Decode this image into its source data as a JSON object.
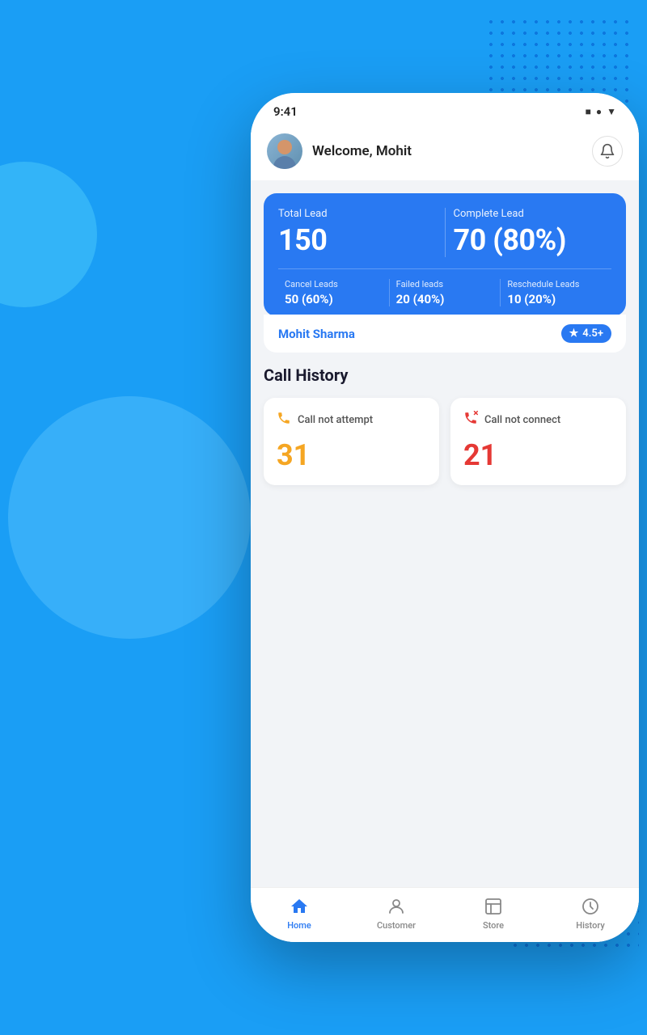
{
  "background": {
    "color": "#1a9ef5"
  },
  "statusBar": {
    "time": "9:41",
    "icons": [
      "■",
      "●",
      "▼"
    ]
  },
  "header": {
    "welcome": "Welcome, Mohit",
    "bell_label": "notifications"
  },
  "leadCard": {
    "total_lead_label": "Total Lead",
    "total_lead_value": "150",
    "complete_lead_label": "Complete Lead",
    "complete_lead_value": "70 (80%)",
    "stats": [
      {
        "label": "Cancel Leads",
        "value": "50 (60%)"
      },
      {
        "label": "Failed leads",
        "value": "20 (40%)"
      },
      {
        "label": "Reschedule Leads",
        "value": "10 (20%)"
      }
    ]
  },
  "profileRow": {
    "name": "Mohit Sharma",
    "rating": "4.5+"
  },
  "callHistory": {
    "section_title": "Call History",
    "cards": [
      {
        "label": "Call not attempt",
        "value": "31",
        "color": "orange",
        "icon": "📞"
      },
      {
        "label": "Call not connect",
        "value": "21",
        "color": "red",
        "icon": "📵"
      }
    ]
  },
  "bottomNav": {
    "items": [
      {
        "label": "Home",
        "active": true,
        "icon": "home"
      },
      {
        "label": "Customer",
        "active": false,
        "icon": "customer"
      },
      {
        "label": "Store",
        "active": false,
        "icon": "store"
      },
      {
        "label": "History",
        "active": false,
        "icon": "history"
      }
    ]
  }
}
